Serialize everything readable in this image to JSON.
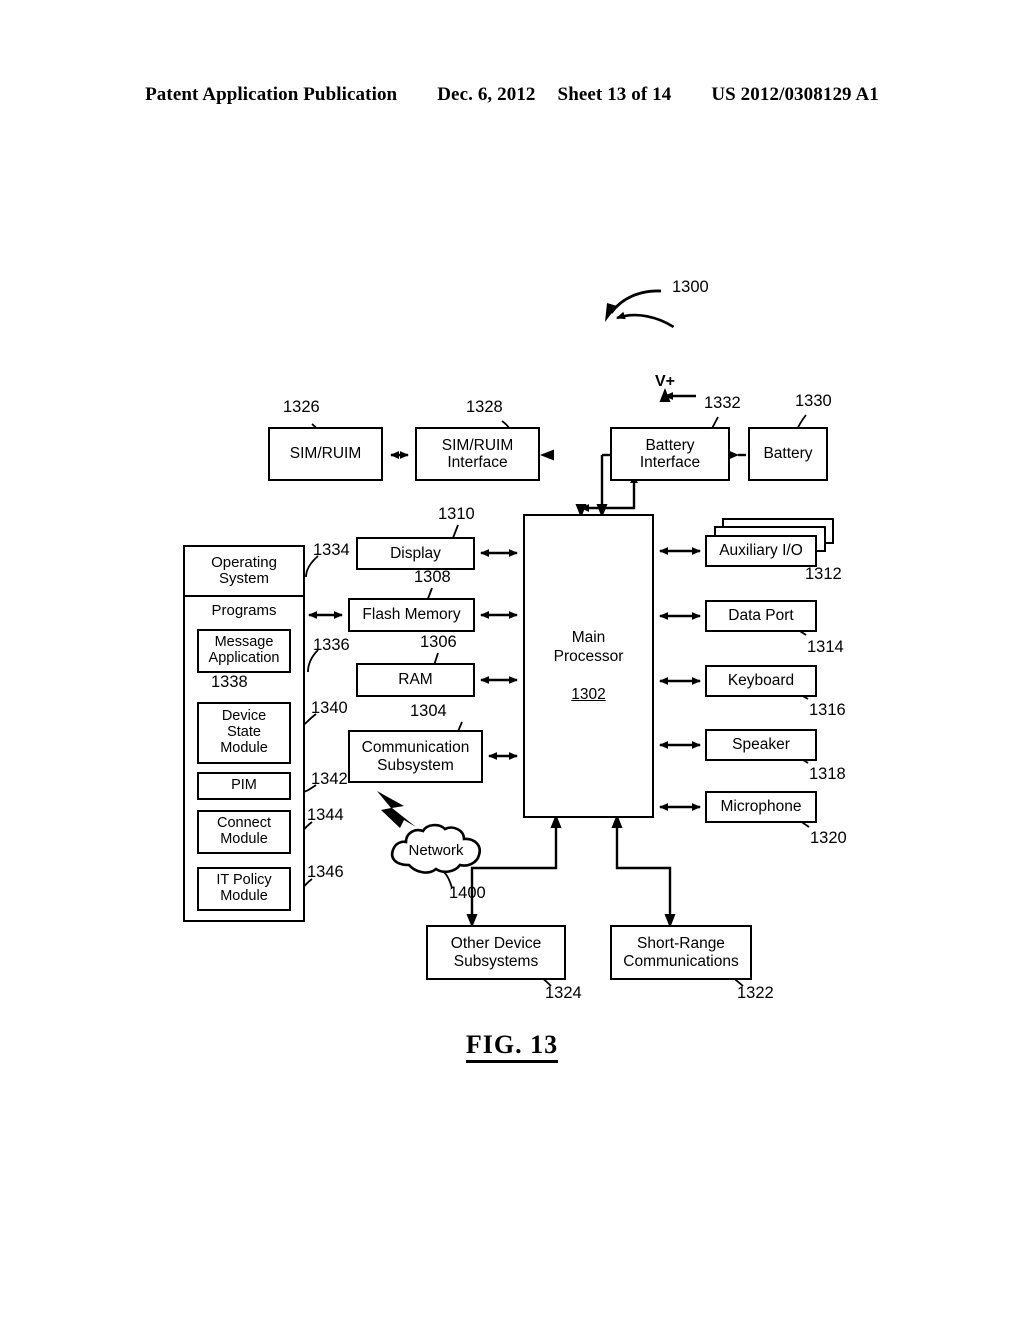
{
  "header": {
    "publication": "Patent Application Publication",
    "date": "Dec. 6, 2012",
    "sheet": "Sheet 13 of 14",
    "pub_number": "US 2012/0308129 A1"
  },
  "figure": {
    "caption": "FIG. 13",
    "diagram_ref": "1300"
  },
  "labels": {
    "v_plus": "V+"
  },
  "nodes": {
    "sim_ruim": {
      "label": "SIM/RUIM",
      "ref": "1326"
    },
    "sim_ruim_interface": {
      "label": "SIM/RUIM Interface",
      "line1": "SIM/RUIM",
      "line2": "Interface",
      "ref": "1328"
    },
    "battery_interface": {
      "label": "Battery Interface",
      "line1": "Battery",
      "line2": "Interface",
      "ref": "1332"
    },
    "battery": {
      "label": "Battery",
      "ref": "1330"
    },
    "display": {
      "label": "Display",
      "ref": "1310"
    },
    "flash_memory": {
      "label": "Flash Memory",
      "ref": "1308"
    },
    "ram": {
      "label": "RAM",
      "ref": "1306"
    },
    "communication_subsystem": {
      "label": "Communication Subsystem",
      "line1": "Communication",
      "line2": "Subsystem",
      "ref": "1304"
    },
    "main_processor": {
      "line1": "Main",
      "line2": "Processor",
      "ref": "1302"
    },
    "auxiliary_io": {
      "label": "Auxiliary I/O",
      "ref": "1312"
    },
    "data_port": {
      "label": "Data Port",
      "ref": "1314"
    },
    "keyboard": {
      "label": "Keyboard",
      "ref": "1316"
    },
    "speaker": {
      "label": "Speaker",
      "ref": "1318"
    },
    "microphone": {
      "label": "Microphone",
      "ref": "1320"
    },
    "network": {
      "label": "Network",
      "ref": "1400"
    },
    "other_device_subsystems": {
      "label": "Other Device Subsystems",
      "line1": "Other Device",
      "line2": "Subsystems",
      "ref": "1324"
    },
    "short_range_communications": {
      "label": "Short-Range Communications",
      "line1": "Short-Range",
      "line2": "Communications",
      "ref": "1322"
    }
  },
  "software_stack": {
    "operating_system": {
      "line1": "Operating",
      "line2": "System",
      "ref": "1334"
    },
    "programs": {
      "label": "Programs",
      "ref": "1336"
    },
    "modules": [
      {
        "key": "message_application",
        "line1": "Message",
        "line2": "Application",
        "ref": "1338"
      },
      {
        "key": "device_state_module",
        "line1": "Device",
        "line2": "State",
        "line3": "Module",
        "ref": "1340"
      },
      {
        "key": "pim",
        "line1": "PIM",
        "ref": "1342"
      },
      {
        "key": "connect_module",
        "line1": "Connect",
        "line2": "Module",
        "ref": "1344"
      },
      {
        "key": "it_policy_module",
        "line1": "IT Policy",
        "line2": "Module",
        "ref": "1346"
      }
    ]
  }
}
